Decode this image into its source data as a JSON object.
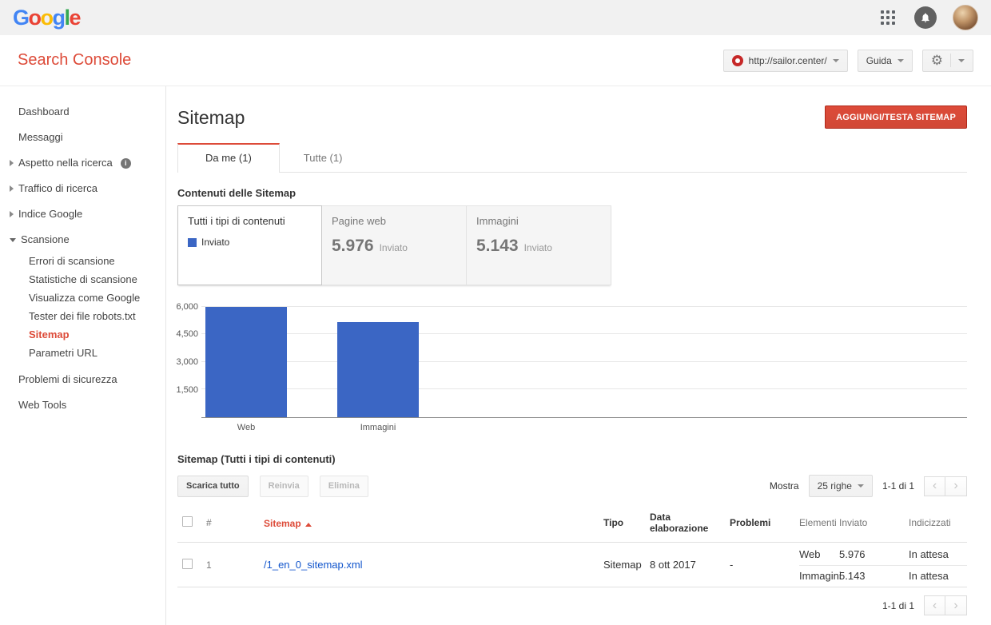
{
  "brand": {
    "logo_letters": [
      {
        "ch": "G",
        "color": "#4285F4"
      },
      {
        "ch": "o",
        "color": "#EA4335"
      },
      {
        "ch": "o",
        "color": "#FBBC05"
      },
      {
        "ch": "g",
        "color": "#4285F4"
      },
      {
        "ch": "l",
        "color": "#34A853"
      },
      {
        "ch": "e",
        "color": "#EA4335"
      }
    ]
  },
  "icons": {
    "gear": "⚙",
    "info": "i",
    "chevron_left": "‹",
    "chevron_right": "›"
  },
  "header": {
    "app_title": "Search Console",
    "property_selector": "http://sailor.center/",
    "help_label": "Guida"
  },
  "sidebar": {
    "items": [
      {
        "label": "Dashboard"
      },
      {
        "label": "Messaggi"
      },
      {
        "label": "Aspetto nella ricerca"
      },
      {
        "label": "Traffico di ricerca"
      },
      {
        "label": "Indice Google"
      },
      {
        "label": "Scansione"
      },
      {
        "label": "Problemi di sicurezza"
      },
      {
        "label": "Web Tools"
      }
    ],
    "scansione_children": [
      "Errori di scansione",
      "Statistiche di scansione",
      "Visualizza come Google",
      "Tester dei file robots.txt",
      "Sitemap",
      "Parametri URL"
    ],
    "active_item": "Sitemap"
  },
  "main": {
    "page_title": "Sitemap",
    "add_button": "AGGIUNGI/TESTA SITEMAP",
    "tabs": [
      {
        "label": "Da me (1)",
        "active": true
      },
      {
        "label": "Tutte (1)",
        "active": false
      }
    ],
    "contents_heading": "Contenuti delle Sitemap",
    "cards": [
      {
        "title": "Tutti i tipi di contenuti",
        "legend": "Inviato"
      },
      {
        "title": "Pagine web",
        "value": "5.976",
        "sub": "Inviato"
      },
      {
        "title": "Immagini",
        "value": "5.143",
        "sub": "Inviato"
      }
    ],
    "table_heading": "Sitemap (Tutti i tipi di contenuti)",
    "toolbar": {
      "download": "Scarica tutto",
      "resubmit": "Reinvia",
      "delete": "Elimina",
      "show_label": "Mostra",
      "rows_per_page": "25 righe",
      "range": "1-1 di 1"
    },
    "table": {
      "columns": {
        "index": "#",
        "sitemap": "Sitemap",
        "tipo": "Tipo",
        "data": "Data elaborazione",
        "problemi": "Problemi",
        "elementi": "Elementi",
        "inviato": "Inviato",
        "indicizzati": "Indicizzati"
      },
      "row": {
        "index": "1",
        "url": "/1_en_0_sitemap.xml",
        "tipo": "Sitemap",
        "data": "8 ott 2017",
        "problemi": "-",
        "details": [
          {
            "label": "Web",
            "inviato": "5.976",
            "indicizzati": "In attesa"
          },
          {
            "label": "Immagini",
            "inviato": "5.143",
            "indicizzati": "In attesa"
          }
        ]
      },
      "footer_range": "1-1 di 1"
    }
  },
  "chart_data": {
    "type": "bar",
    "title": "Contenuti delle Sitemap",
    "categories": [
      "Web",
      "Immagini"
    ],
    "series": [
      {
        "name": "Inviato",
        "values": [
          5976,
          5143
        ]
      }
    ],
    "xlabel": "",
    "ylabel": "",
    "ylim": [
      0,
      6200
    ],
    "yticks": [
      1500,
      3000,
      4500,
      6000
    ],
    "ytick_labels": [
      "1,500",
      "3,000",
      "4,500",
      "6,000"
    ],
    "bar_color": "#3b66c4",
    "grid": true,
    "legend_position": "card"
  }
}
